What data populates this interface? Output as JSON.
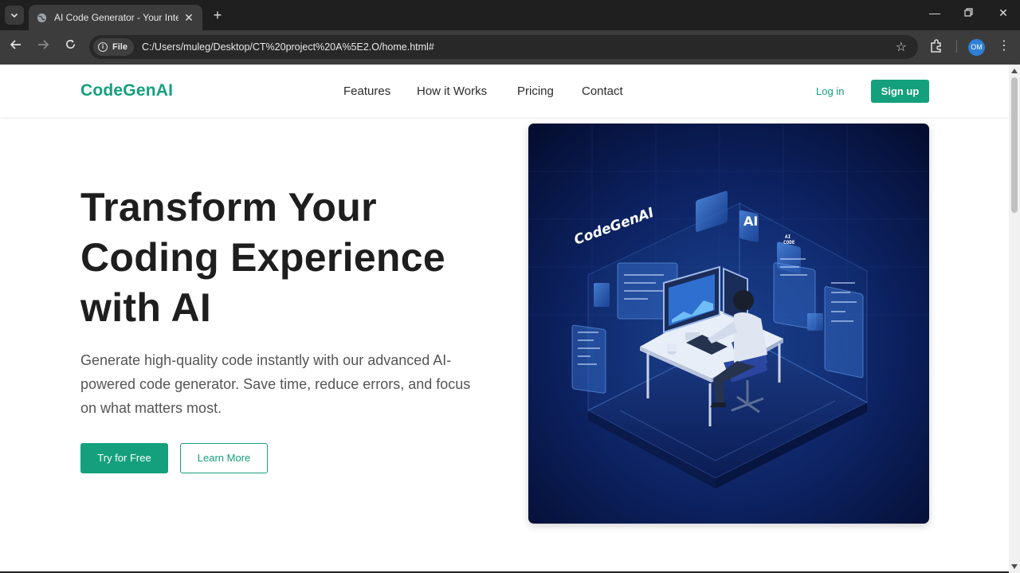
{
  "browser": {
    "tab_title": "AI Code Generator - Your Intelli",
    "site_chip": "File",
    "url": "C:/Users/muleg/Desktop/CT%20project%20A%5E2.O/home.html#",
    "profile_initials": "OM"
  },
  "header": {
    "logo": "CodeGenAI",
    "nav": [
      "Features",
      "How it Works",
      "Pricing",
      "Contact"
    ],
    "login": "Log in",
    "signup": "Sign up"
  },
  "hero": {
    "title_lines": [
      "Transform Your",
      "Coding Experience",
      "with AI"
    ],
    "subtitle": "Generate high-quality code instantly with our advanced AI-powered code generator. Save time, reduce errors, and focus on what matters most.",
    "primary_cta": "Try for Free",
    "secondary_cta": "Learn More",
    "image": {
      "brand_text": "CodeGenAI",
      "badge_text": "AI",
      "small_badge_lines": [
        "AI",
        "CODE"
      ]
    }
  },
  "colors": {
    "accent": "#14a07c",
    "chrome_dark": "#1f1f1f",
    "chrome_toolbar": "#3c3c3c",
    "hero_image_bg": "#0a1a48"
  }
}
